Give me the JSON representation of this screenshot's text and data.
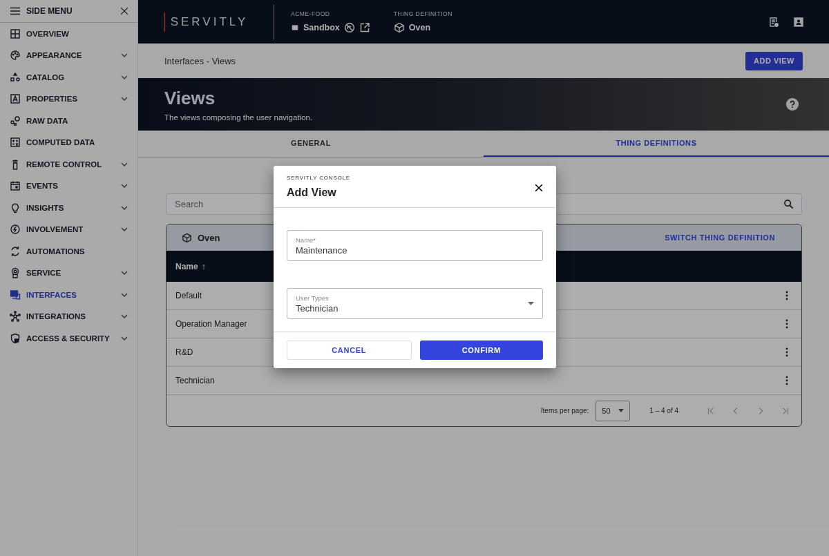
{
  "side_menu": {
    "title": "SIDE MENU",
    "items": [
      {
        "label": "OVERVIEW",
        "expandable": false,
        "selected": false
      },
      {
        "label": "APPEARANCE",
        "expandable": true,
        "selected": false
      },
      {
        "label": "CATALOG",
        "expandable": true,
        "selected": false
      },
      {
        "label": "PROPERTIES",
        "expandable": true,
        "selected": false
      },
      {
        "label": "RAW DATA",
        "expandable": false,
        "selected": false
      },
      {
        "label": "COMPUTED DATA",
        "expandable": false,
        "selected": false
      },
      {
        "label": "REMOTE CONTROL",
        "expandable": true,
        "selected": false
      },
      {
        "label": "EVENTS",
        "expandable": true,
        "selected": false
      },
      {
        "label": "INSIGHTS",
        "expandable": true,
        "selected": false
      },
      {
        "label": "INVOLVEMENT",
        "expandable": true,
        "selected": false
      },
      {
        "label": "AUTOMATIONS",
        "expandable": false,
        "selected": false
      },
      {
        "label": "SERVICE",
        "expandable": true,
        "selected": false
      },
      {
        "label": "INTERFACES",
        "expandable": true,
        "selected": true
      },
      {
        "label": "INTEGRATIONS",
        "expandable": true,
        "selected": false
      },
      {
        "label": "ACCESS & SECURITY",
        "expandable": true,
        "selected": false
      }
    ]
  },
  "header": {
    "logo": "SERVITLY",
    "tenant_label": "ACME-FOOD",
    "tenant": "Sandbox",
    "thing_definition_label": "THING DEFINITION",
    "thing_definition": "Oven"
  },
  "breadcrumb": "Interfaces - Views",
  "add_button": "ADD VIEW",
  "banner": {
    "title": "Views",
    "subtitle": "The views composing the user navigation."
  },
  "tabs": [
    {
      "label": "GENERAL",
      "selected": false
    },
    {
      "label": "THING DEFINITIONS",
      "selected": true
    }
  ],
  "search": {
    "placeholder": "Search"
  },
  "card": {
    "title": "Oven",
    "action": "SWITCH THING DEFINITION"
  },
  "table": {
    "column": "Name",
    "sort_indicator": "↑",
    "rows": [
      {
        "name": "Default"
      },
      {
        "name": "Operation Manager"
      },
      {
        "name": "R&D"
      },
      {
        "name": "Technician"
      }
    ]
  },
  "paginator": {
    "label": "Items per page:",
    "page_size": "50",
    "range": "1 – 4 of 4"
  },
  "dialog": {
    "overline": "SERVITLY CONSOLE",
    "title": "Add View",
    "fields": [
      {
        "kind": "text",
        "label": "Name*",
        "value": "Maintenance"
      },
      {
        "kind": "select",
        "label": "User Types",
        "value": "Technician"
      }
    ],
    "buttons": [
      {
        "kind": "secondary",
        "label": "CANCEL"
      },
      {
        "kind": "primary",
        "label": "CONFIRM"
      }
    ]
  }
}
